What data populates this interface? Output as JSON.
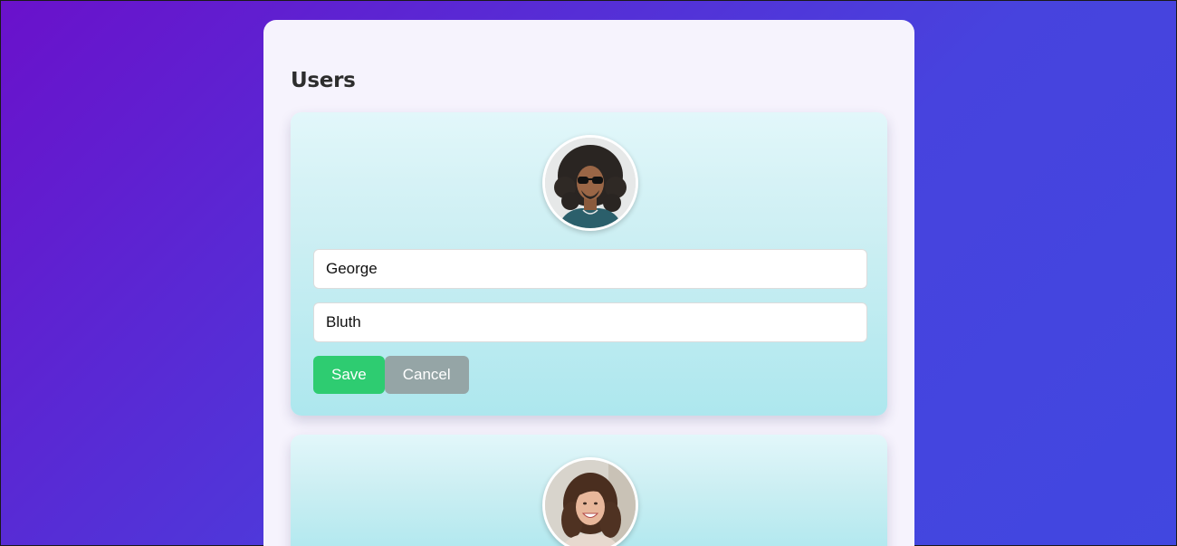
{
  "page": {
    "title": "Users"
  },
  "users": [
    {
      "avatar": "curly-hair-man-sunglasses-photo",
      "first_name": "George",
      "last_name": "Bluth",
      "save_label": "Save",
      "cancel_label": "Cancel"
    },
    {
      "avatar": "smiling-woman-photo"
    }
  ],
  "colors": {
    "background_gradient_start": "#6a11cb",
    "background_gradient_end": "#4147e0",
    "panel": "#f6f3fd",
    "card_top": "#e2f7fa",
    "card_bottom": "#ade7ee",
    "save_button": "#2ecc71",
    "cancel_button": "#95a5a6"
  }
}
